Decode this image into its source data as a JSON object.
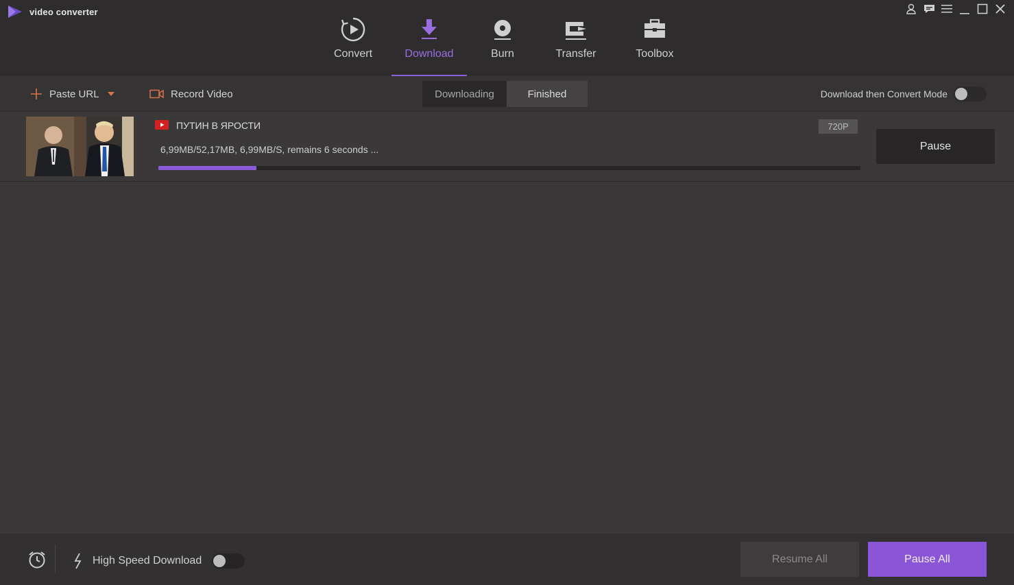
{
  "app": {
    "title": "video converter",
    "accent_color": "#8a55d6"
  },
  "window_controls": [
    {
      "icon": "user-icon"
    },
    {
      "icon": "feedback-icon"
    },
    {
      "icon": "menu-icon"
    },
    {
      "icon": "minimize-icon"
    },
    {
      "icon": "maximize-icon"
    },
    {
      "icon": "close-icon"
    }
  ],
  "nav": {
    "tabs": [
      {
        "label": "Convert",
        "icon": "convert-icon",
        "active": false
      },
      {
        "label": "Download",
        "icon": "download-icon",
        "active": true
      },
      {
        "label": "Burn",
        "icon": "burn-icon",
        "active": false
      },
      {
        "label": "Transfer",
        "icon": "transfer-icon",
        "active": false
      },
      {
        "label": "Toolbox",
        "icon": "toolbox-icon",
        "active": false
      }
    ]
  },
  "toolbar": {
    "paste_url_label": "Paste URL",
    "record_video_label": "Record Video",
    "segments": {
      "downloading": "Downloading",
      "finished": "Finished",
      "active": "Downloading"
    },
    "mode_label": "Download then Convert Mode",
    "mode_enabled": false
  },
  "downloads": [
    {
      "source": "youtube-icon",
      "title": "ПУТИН В ЯРОСТИ",
      "resolution": "720P",
      "progress_text": "6,99MB/52,17MB, 6,99MB/S, remains 6 seconds ...",
      "progress": 0.14,
      "action_label": "Pause"
    }
  ],
  "bottom": {
    "high_speed_label": "High Speed Download",
    "high_speed_enabled": false,
    "resume_all_label": "Resume All",
    "pause_all_label": "Pause All"
  }
}
